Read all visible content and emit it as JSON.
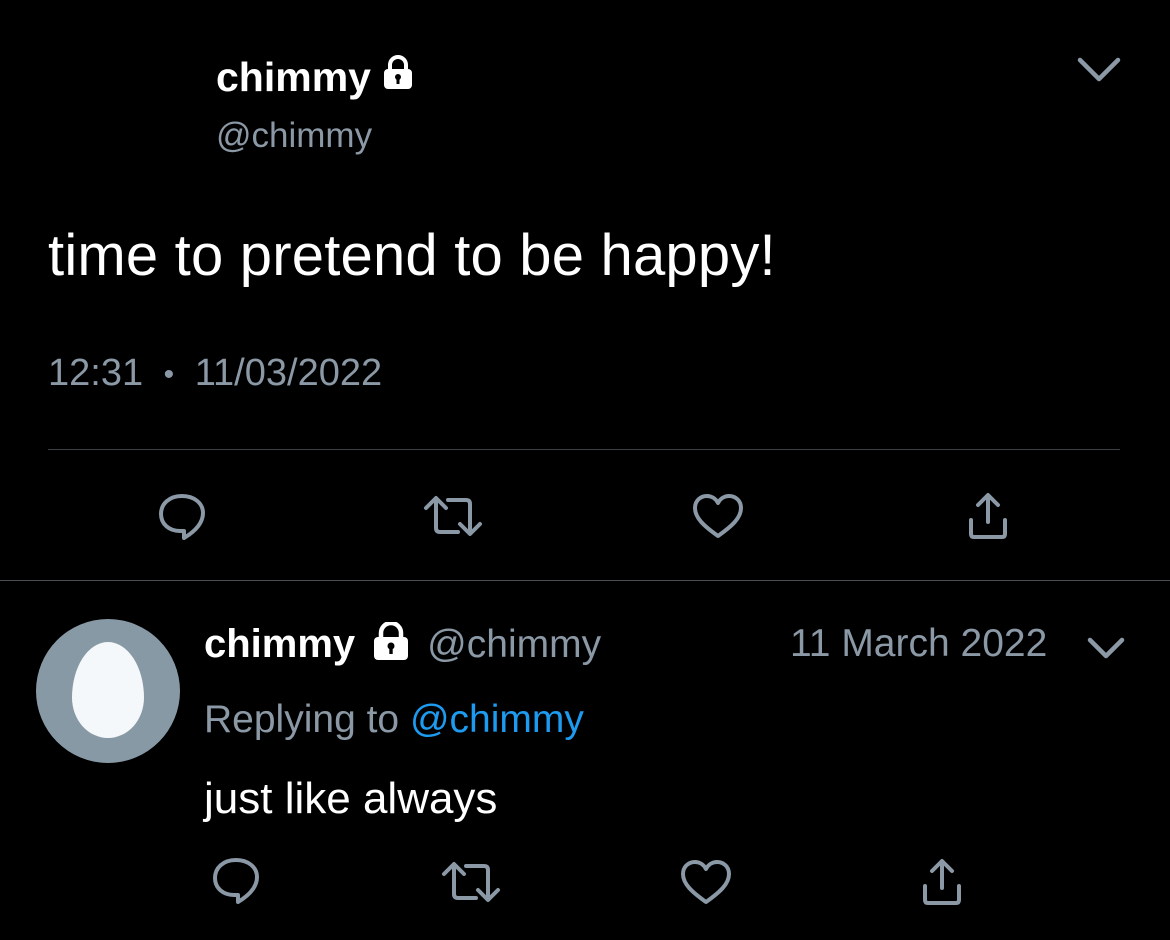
{
  "main_tweet": {
    "display_name": "chimmy",
    "handle": "@chimmy",
    "text": "time to pretend to be happy!",
    "time": "12:31",
    "separator": "•",
    "date": "11/03/2022",
    "icons": {
      "protected": "lock-icon",
      "menu": "chevron-down-icon"
    }
  },
  "actions": [
    "reply-icon",
    "retweet-icon",
    "like-icon",
    "share-icon"
  ],
  "reply_tweet": {
    "display_name": "chimmy",
    "handle": "@chimmy",
    "date": "11 March 2022",
    "replying_prefix": "Replying to",
    "replying_to": "@chimmy",
    "text": "just like always",
    "avatar": "default-egg-avatar"
  },
  "colors": {
    "background": "#000000",
    "text": "#ffffff",
    "secondary": "#8b98a5",
    "accent": "#1d9bf0",
    "divider": "#3b4046"
  }
}
